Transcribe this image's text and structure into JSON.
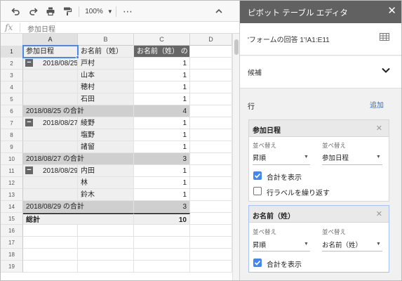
{
  "toolbar": {
    "zoom": "100%",
    "more": "⋯",
    "collapse": "⌃"
  },
  "formula_bar": {
    "fx": "fx",
    "value": "参加日程"
  },
  "columns": [
    "A",
    "B",
    "C",
    "D"
  ],
  "rows": [
    {
      "n": "1",
      "a": "参加日程",
      "b": "お名前（姓）",
      "c": "お名前（姓） の"
    },
    {
      "n": "2",
      "a": "2018/08/25",
      "b": "戸村",
      "c": "1"
    },
    {
      "n": "3",
      "a": "",
      "b": "山本",
      "c": "1"
    },
    {
      "n": "4",
      "a": "",
      "b": "穂村",
      "c": "1"
    },
    {
      "n": "5",
      "a": "",
      "b": "石田",
      "c": "1"
    },
    {
      "n": "6",
      "a": "2018/08/25 の合計",
      "b": "",
      "c": "4"
    },
    {
      "n": "7",
      "a": "2018/08/27",
      "b": "綾野",
      "c": "1"
    },
    {
      "n": "8",
      "a": "",
      "b": "塩野",
      "c": "1"
    },
    {
      "n": "9",
      "a": "",
      "b": "諸留",
      "c": "1"
    },
    {
      "n": "10",
      "a": "2018/08/27 の合計",
      "b": "",
      "c": "3"
    },
    {
      "n": "11",
      "a": "2018/08/29",
      "b": "内田",
      "c": "1"
    },
    {
      "n": "12",
      "a": "",
      "b": "林",
      "c": "1"
    },
    {
      "n": "13",
      "a": "",
      "b": "鈴木",
      "c": "1"
    },
    {
      "n": "14",
      "a": "2018/08/29 の合計",
      "b": "",
      "c": "3"
    },
    {
      "n": "15",
      "a": "総計",
      "b": "",
      "c": "10"
    },
    {
      "n": "16",
      "a": "",
      "b": "",
      "c": ""
    },
    {
      "n": "17",
      "a": "",
      "b": "",
      "c": ""
    },
    {
      "n": "18",
      "a": "",
      "b": "",
      "c": ""
    },
    {
      "n": "19",
      "a": "",
      "b": "",
      "c": ""
    }
  ],
  "collapse_symbol": "−",
  "panel": {
    "title": "ピボット テーブル エディタ",
    "close": "✕",
    "source": "'フォームの回答 1'!A1:E11",
    "candidates": "候補",
    "rows_label": "行",
    "add": "追加",
    "cards": [
      {
        "title": "参加日程",
        "close": "✕",
        "sort_label": "並べ替え",
        "sort_value": "昇順",
        "sortby_label": "並べ替え",
        "sortby_value": "参加日程",
        "show_totals": "合計を表示",
        "show_totals_checked": true,
        "repeat_labels": "行ラベルを繰り返す",
        "repeat_labels_checked": false
      },
      {
        "title": "お名前（姓）",
        "close": "✕",
        "sort_label": "並べ替え",
        "sort_value": "昇順",
        "sortby_label": "並べ替え",
        "sortby_value": "お名前（姓）",
        "show_totals": "合計を表示",
        "show_totals_checked": true
      }
    ]
  },
  "colors": {
    "accent": "#4285f4",
    "panel_header": "#616161",
    "link": "#1a73e8",
    "header_row": "#666666",
    "total_row": "#cfcfcf"
  }
}
